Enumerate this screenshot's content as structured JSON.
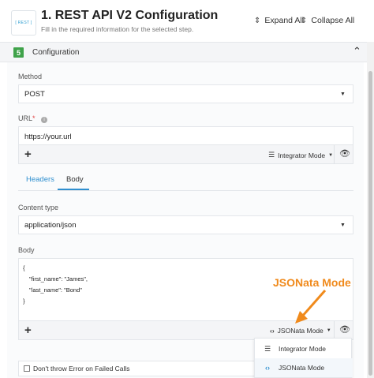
{
  "header": {
    "logo_text": "[ REST ]",
    "title": "1. REST API V2 Configuration",
    "subtitle": "Fill in the required information for the selected step.",
    "expand_all": "Expand All",
    "collapse_all": "Collapse All"
  },
  "step": {
    "number": "5",
    "label": "Configuration"
  },
  "method": {
    "label": "Method",
    "value": "POST"
  },
  "url": {
    "label": "URL",
    "required_mark": "*",
    "value": "https://your.url",
    "mode_label": "Integrator Mode"
  },
  "tabs": [
    {
      "label": "Headers",
      "active": false
    },
    {
      "label": "Body",
      "active": true
    }
  ],
  "content_type": {
    "label": "Content type",
    "value": "application/json"
  },
  "body": {
    "label": "Body",
    "lines": [
      "{",
      "\"first_name\": \"James\",",
      "\"last_name\": \"Bond\"",
      "}"
    ],
    "mode_label": "JSONata Mode"
  },
  "annotation": "JSONata Mode",
  "mode_menu": [
    {
      "label": "Integrator Mode",
      "icon": "integrator-mode-icon"
    },
    {
      "label": "JSONata Mode",
      "icon": "code-brackets-icon"
    }
  ],
  "checkbox": {
    "label": "Don't throw Error on Failed Calls"
  },
  "colors": {
    "accent": "#2f8fcf",
    "step_badge": "#3fa24a",
    "annotation": "#f08a1c"
  }
}
